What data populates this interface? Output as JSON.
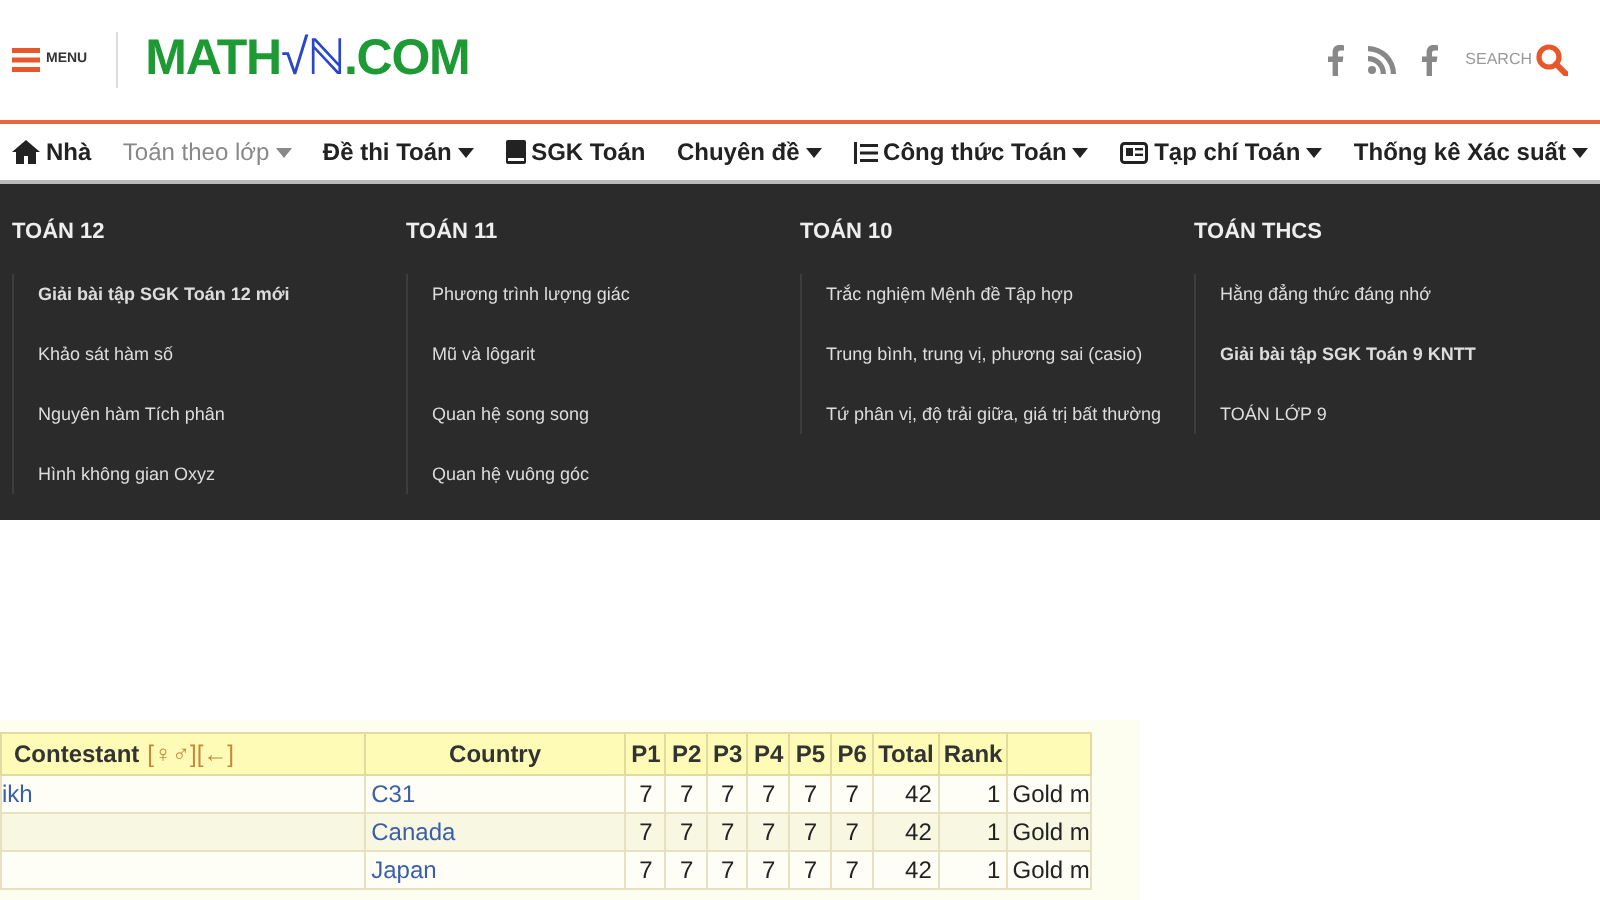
{
  "header": {
    "menu_label": "MENU",
    "logo": {
      "left": "MATH",
      "middle": "√ℕ",
      "right": ".COM"
    },
    "search_label": "SEARCH"
  },
  "nav": [
    {
      "label": "Nhà",
      "kind": "home",
      "dropdown": false,
      "selected": false
    },
    {
      "label": "Toán theo lớp",
      "kind": "plain",
      "dropdown": true,
      "selected": true
    },
    {
      "label": "Đề thi Toán",
      "kind": "plain",
      "dropdown": true,
      "selected": false
    },
    {
      "label": "SGK Toán",
      "kind": "book",
      "dropdown": false,
      "selected": false
    },
    {
      "label": "Chuyên đề",
      "kind": "plain",
      "dropdown": true,
      "selected": false
    },
    {
      "label": "Công thức Toán",
      "kind": "list",
      "dropdown": true,
      "selected": false
    },
    {
      "label": "Tạp chí Toán",
      "kind": "newspaper",
      "dropdown": true,
      "selected": false
    },
    {
      "label": "Thống kê Xác suất",
      "kind": "plain",
      "dropdown": true,
      "selected": false
    }
  ],
  "mega_menu": [
    {
      "heading": "TOÁN 12",
      "items": [
        {
          "label": "Giải bài tập SGK Toán 12 mới",
          "bold": true
        },
        {
          "label": "Khảo sát hàm số",
          "bold": false
        },
        {
          "label": "Nguyên hàm Tích phân",
          "bold": false
        },
        {
          "label": "Hình không gian Oxyz",
          "bold": false
        }
      ]
    },
    {
      "heading": "TOÁN 11",
      "items": [
        {
          "label": "Phương trình lượng giác",
          "bold": false
        },
        {
          "label": "Mũ và lôgarit",
          "bold": false
        },
        {
          "label": "Quan hệ song song",
          "bold": false
        },
        {
          "label": "Quan hệ vuông góc",
          "bold": false
        }
      ]
    },
    {
      "heading": "TOÁN 10",
      "items": [
        {
          "label": "Trắc nghiệm Mệnh đề Tập hợp",
          "bold": false
        },
        {
          "label": "Trung bình, trung vị, phương sai (casio)",
          "bold": false
        },
        {
          "label": "Tứ phân vị, độ trải giữa, giá trị bất thường",
          "bold": false
        }
      ]
    },
    {
      "heading": "TOÁN THCS",
      "items": [
        {
          "label": "Hằng đẳng thức đáng nhớ",
          "bold": false
        },
        {
          "label": "Giải bài tập SGK Toán 9 KNTT",
          "bold": true
        },
        {
          "label": "TOÁN LỚP 9",
          "bold": false
        }
      ]
    }
  ],
  "table": {
    "contestant_header": "Contestant",
    "contestant_links": "[♀♂][←]",
    "columns": [
      "Country",
      "P1",
      "P2",
      "P3",
      "P4",
      "P5",
      "P6",
      "Total",
      "Rank"
    ],
    "rows": [
      {
        "contestant": "ikh",
        "cells": [
          "C31",
          "7",
          "7",
          "7",
          "7",
          "7",
          "7",
          "42",
          "1"
        ],
        "award": "Gold m"
      },
      {
        "cells": [
          "Canada",
          "7",
          "7",
          "7",
          "7",
          "7",
          "7",
          "42",
          "1"
        ],
        "award": "Gold m"
      },
      {
        "cells": [
          "Japan",
          "7",
          "7",
          "7",
          "7",
          "7",
          "7",
          "42",
          "1"
        ],
        "award": "Gold m"
      }
    ]
  }
}
